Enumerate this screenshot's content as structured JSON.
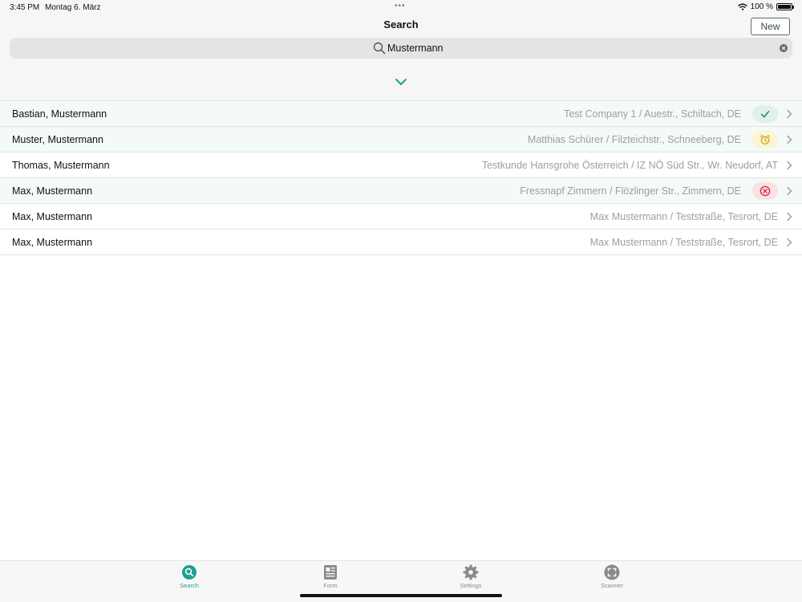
{
  "status": {
    "time": "3:45 PM",
    "date": "Montag 6. März",
    "battery": "100 %",
    "battery_level": 1.0
  },
  "header": {
    "title": "Search",
    "new_label": "New"
  },
  "search": {
    "value": "Mustermann",
    "placeholder": "Search"
  },
  "rows": [
    {
      "name": "Bastian, Mustermann",
      "detail": "Test Company 1 / Auestr., Schiltach, DE",
      "status": "done",
      "tinted": true
    },
    {
      "name": "Muster, Mustermann",
      "detail": "Matthias Schürer / Filzteichstr., Schneeberg, DE",
      "status": "pending",
      "tinted": true
    },
    {
      "name": "Thomas, Mustermann",
      "detail": "Testkunde Hansgrohe Österreich / IZ NÖ Süd Str., Wr. Neudorf, AT",
      "status": "none",
      "tinted": false
    },
    {
      "name": "Max, Mustermann",
      "detail": "Fressnapf Zimmern / Flözlinger Str., Zimmern, DE",
      "status": "failed",
      "tinted": true
    },
    {
      "name": "Max, Mustermann",
      "detail": "Max Mustermann / Teststraße, Tesrort, DE",
      "status": "none",
      "tinted": false
    },
    {
      "name": "Max, Mustermann",
      "detail": "Max Mustermann / Teststraße, Tesrort, DE",
      "status": "none",
      "tinted": false
    }
  ],
  "status_badges": {
    "done": {
      "icon": "check-icon",
      "bg": "#dff1e9",
      "color": "#2e7d5b"
    },
    "pending": {
      "icon": "alarm-clock-icon",
      "bg": "#fbf5d6",
      "color": "#c9a400"
    },
    "failed": {
      "icon": "x-circle-icon",
      "bg": "#fae1e3",
      "color": "#d0233a"
    }
  },
  "tabs": [
    {
      "label": "Search",
      "icon": "search-icon",
      "active": true
    },
    {
      "label": "Form",
      "icon": "form-icon",
      "active": false
    },
    {
      "label": "Settings",
      "icon": "gear-icon",
      "active": false
    },
    {
      "label": "Scanner",
      "icon": "scanner-icon",
      "active": false
    }
  ],
  "colors": {
    "accent": "#20a08e",
    "row_tint": "#f3faf8",
    "muted_text": "#9aa0a3"
  }
}
